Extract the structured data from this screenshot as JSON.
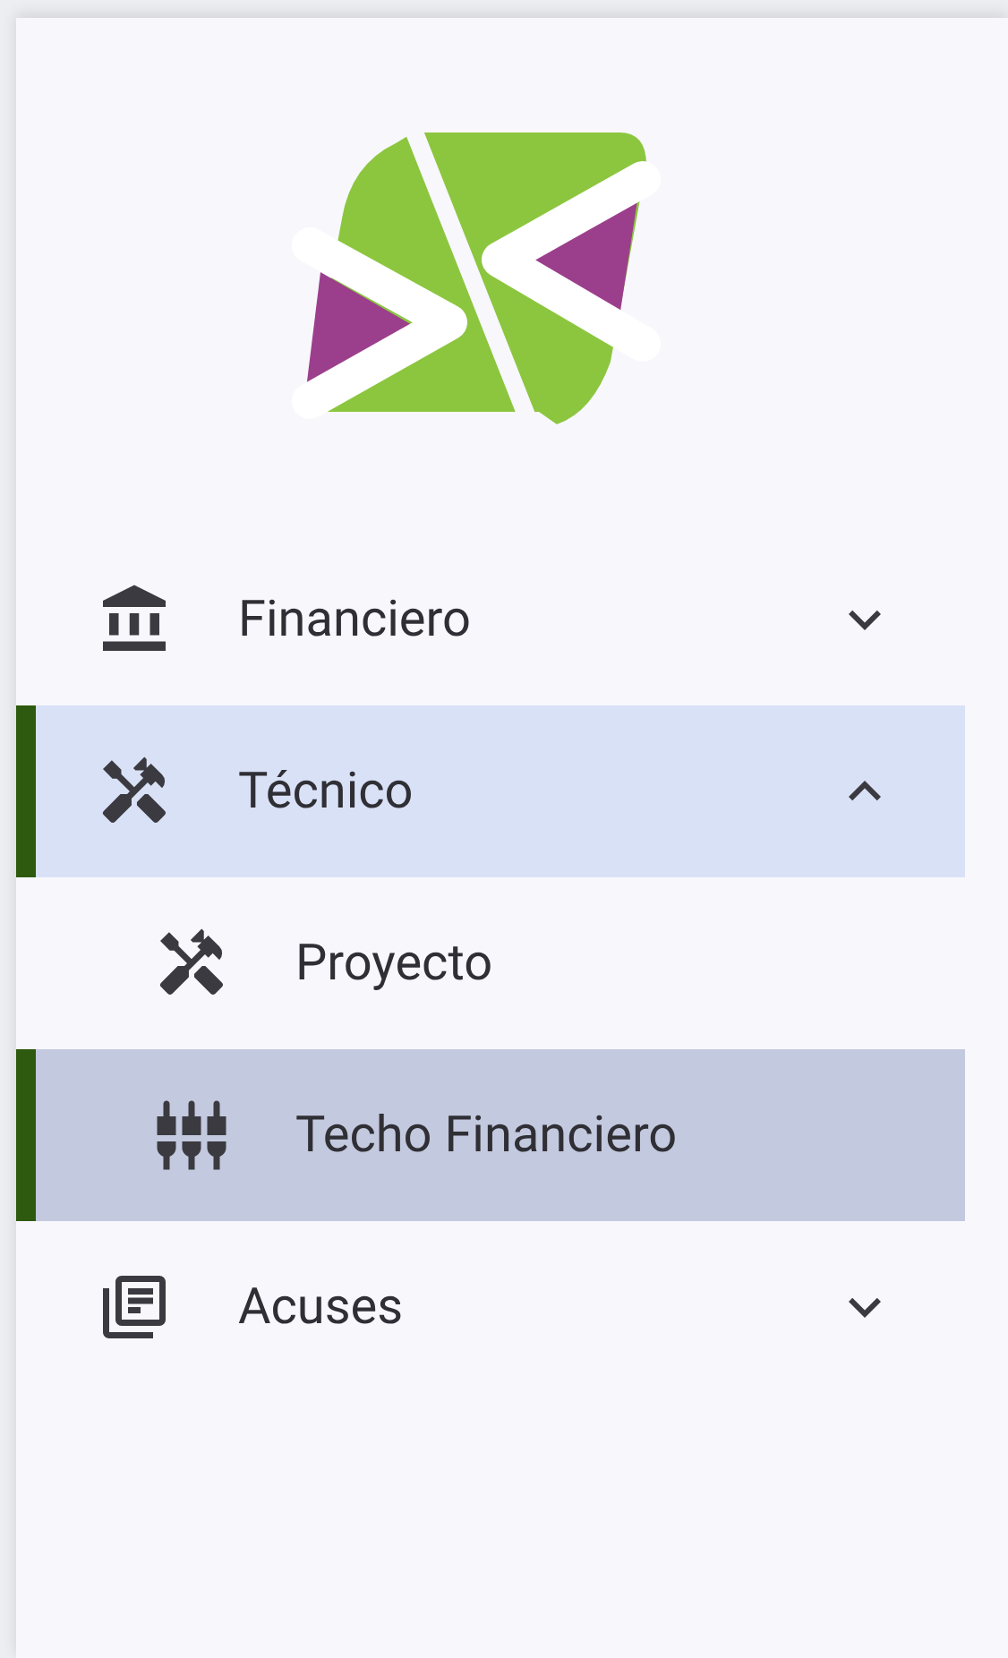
{
  "menu": [
    {
      "label": "Financiero",
      "selected": false,
      "expanded": false
    },
    {
      "label": "Técnico",
      "selected": true,
      "expanded": true,
      "children": [
        {
          "label": "Proyecto",
          "selected": false
        },
        {
          "label": "Techo Financiero",
          "selected": true
        }
      ]
    },
    {
      "label": "Acuses",
      "selected": false,
      "expanded": false
    }
  ]
}
